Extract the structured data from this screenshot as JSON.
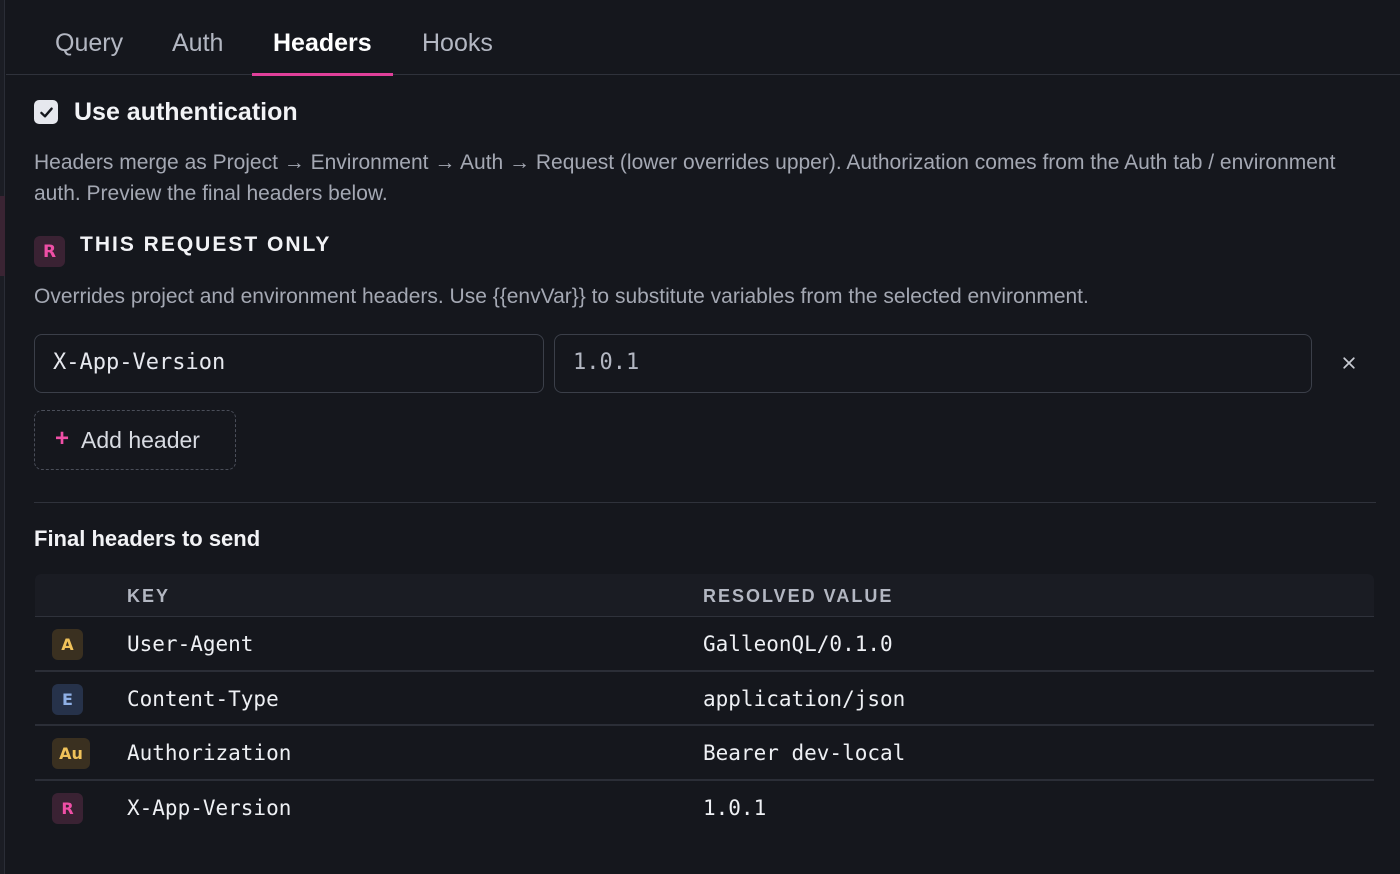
{
  "tabs": [
    {
      "label": "Query"
    },
    {
      "label": "Auth"
    },
    {
      "label": "Headers",
      "active": true
    },
    {
      "label": "Hooks"
    }
  ],
  "use_auth": {
    "label": "Use authentication",
    "checked": true
  },
  "description": "Headers merge as Project → Environment → Auth → Request (lower overrides upper). Authorization comes from the Auth tab / environment auth. Preview the final headers below.",
  "request_section": {
    "badge": "R",
    "title": "THIS REQUEST ONLY",
    "description": "Overrides project and environment headers. Use {{envVar}} to substitute variables from the selected environment.",
    "header_key": "X-App-Version",
    "header_value": "1.0.1",
    "remove_icon": "close-icon",
    "add_button": {
      "icon": "+",
      "label": "Add header"
    }
  },
  "final_headers": {
    "title": "Final headers to send",
    "columns": {
      "key": "KEY",
      "value": "RESOLVED VALUE"
    },
    "rows": [
      {
        "source": "A",
        "key": "User-Agent",
        "value": "GalleonQL/0.1.0"
      },
      {
        "source": "E",
        "key": "Content-Type",
        "value": "application/json"
      },
      {
        "source": "Au",
        "key": "Authorization",
        "value": "Bearer dev-local"
      },
      {
        "source": "R",
        "key": "X-App-Version",
        "value": "1.0.1"
      }
    ]
  },
  "colors": {
    "accent": "#e0409a",
    "background": "#15171d"
  }
}
